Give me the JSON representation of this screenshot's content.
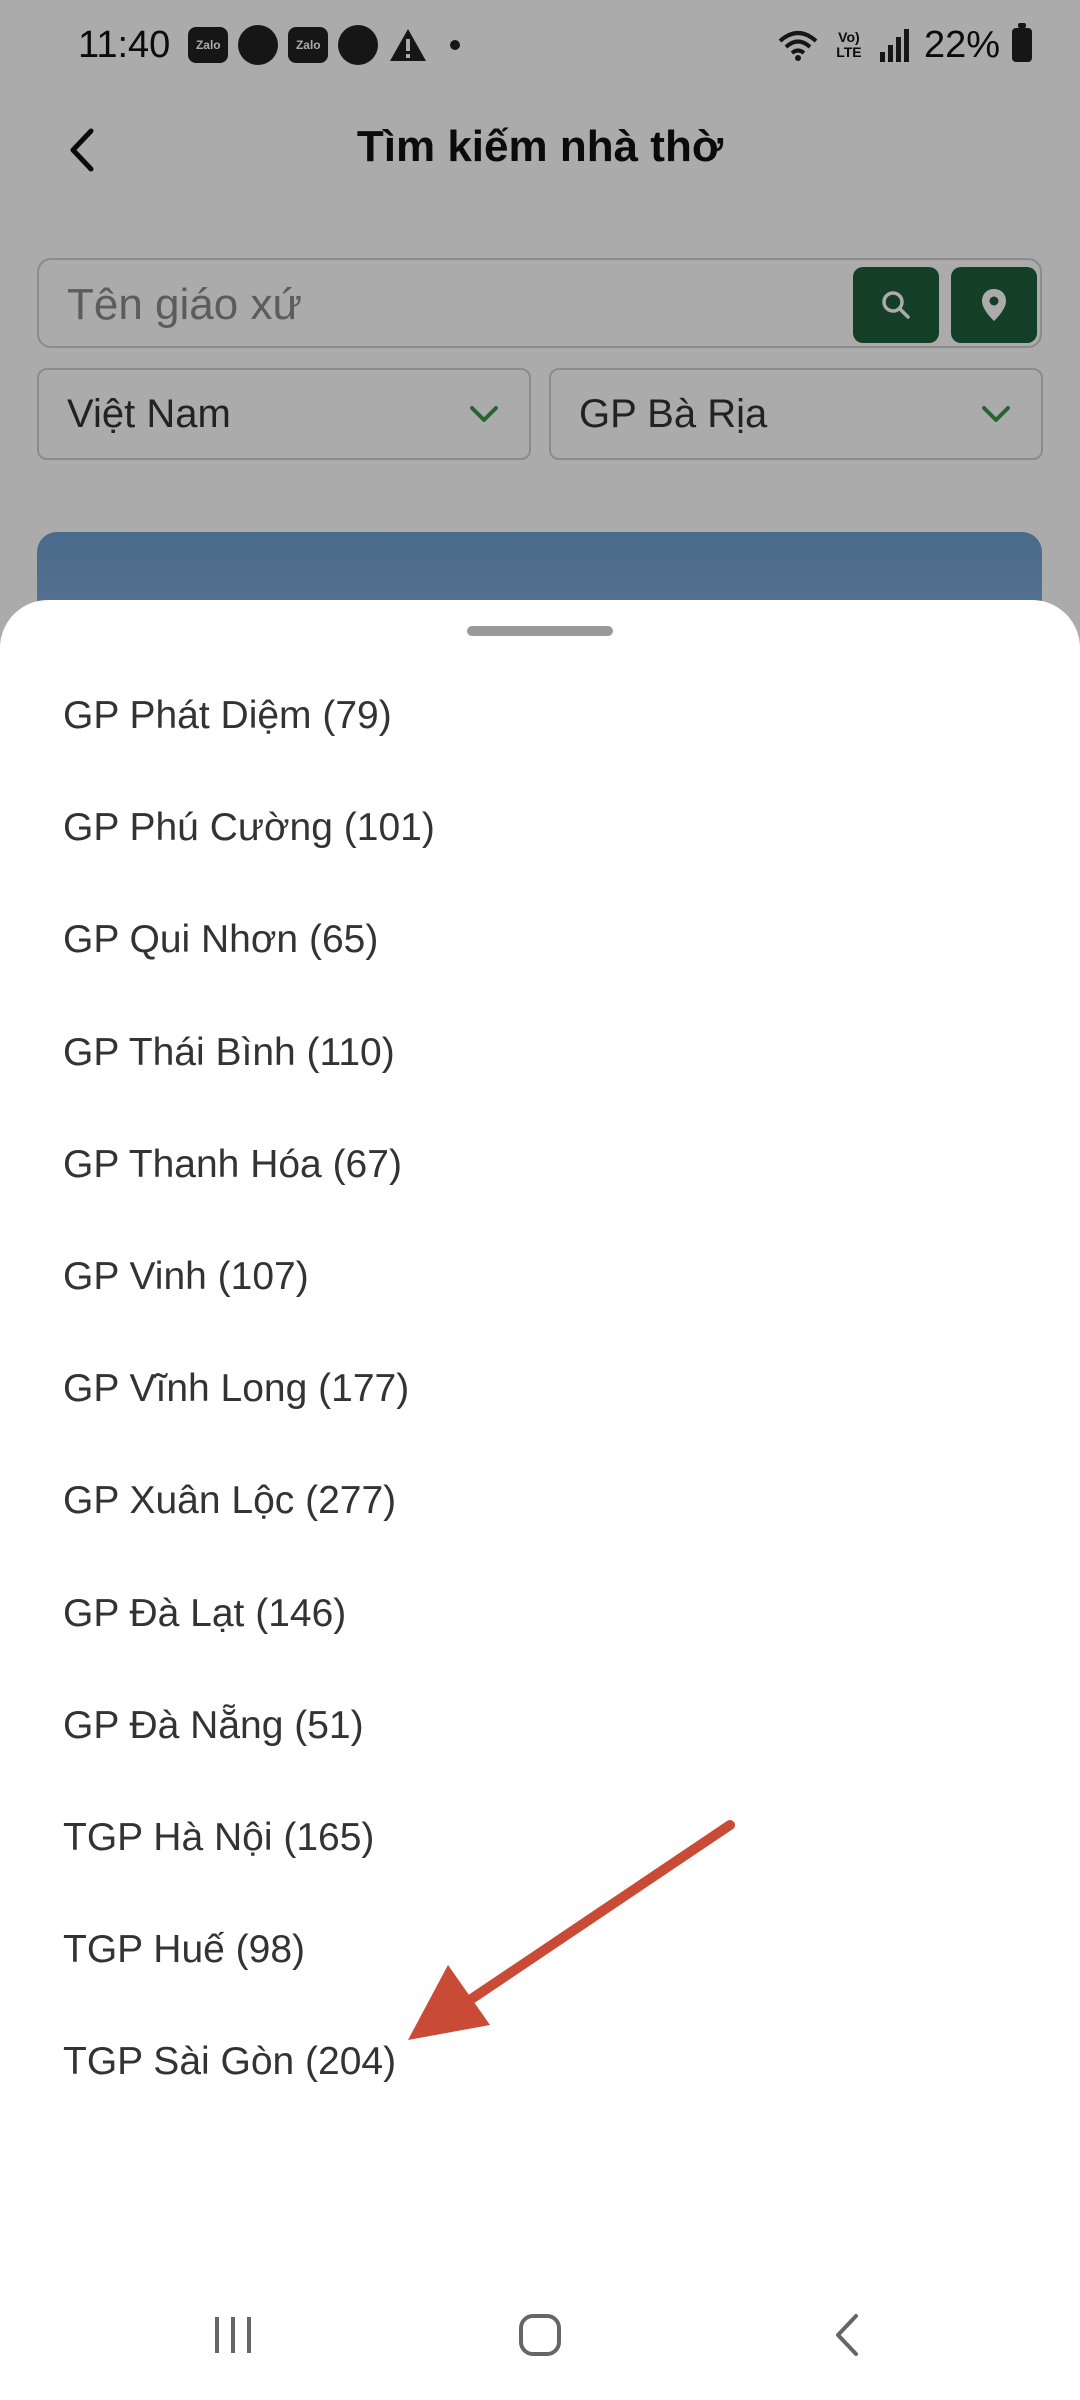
{
  "status_bar": {
    "time": "11:40",
    "notification_icons": [
      "zalo-icon",
      "viber-icon",
      "zalo-icon",
      "messenger-icon",
      "warning-icon"
    ],
    "network_label": "Vo) LTE",
    "battery": "22%"
  },
  "header": {
    "title": "Tìm kiếm nhà thờ"
  },
  "search": {
    "placeholder": "Tên giáo xứ"
  },
  "filters": {
    "country": "Việt Nam",
    "diocese": "GP Bà Rịa"
  },
  "dropdown": {
    "options": [
      "GP Phát Diệm (79)",
      "GP Phú Cường (101)",
      "GP Qui Nhơn (65)",
      "GP Thái Bình (110)",
      "GP Thanh Hóa (67)",
      "GP Vinh (107)",
      "GP Vĩnh Long (177)",
      "GP Xuân Lộc (277)",
      "GP Đà Lạt (146)",
      "GP Đà Nẵng (51)",
      "TGP Hà Nội (165)",
      "TGP Huế (98)",
      "TGP Sài Gòn (204)"
    ]
  },
  "colors": {
    "accent_green": "#1e5e3a",
    "chevron_green": "#3a9a4a",
    "annotation_red": "#c94a35"
  }
}
